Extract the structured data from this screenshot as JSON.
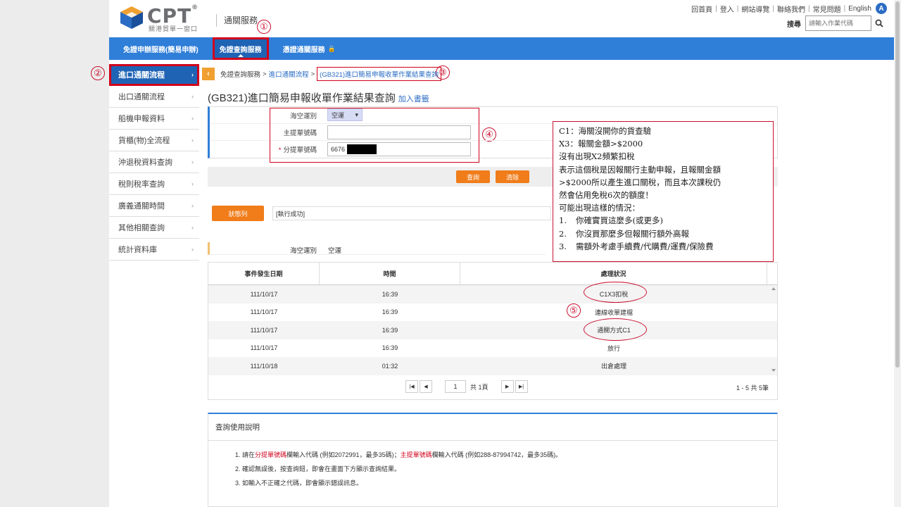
{
  "header": {
    "brand": "CPT",
    "reg": "®",
    "tagline": "關港貿單一窗口",
    "site_title": "通關服務",
    "top_links": [
      "回首頁",
      "登入",
      "網站導覽",
      "聯絡我們",
      "常見問題",
      "English"
    ],
    "globe_letter": "A",
    "search_label": "搜尋",
    "search_placeholder": "請輸入作業代碼"
  },
  "nav": {
    "items": [
      "免證申辦服務(簡易申辦)",
      "免證查詢服務",
      "憑證通關服務"
    ]
  },
  "annotations": {
    "a1": "①",
    "a2": "②",
    "a3": "③",
    "a4": "④",
    "a5": "⑤"
  },
  "sidebar": {
    "items": [
      "進口通關流程",
      "出口通關流程",
      "船機申報資料",
      "貨櫃(物)全流程",
      "沖退稅資料查詢",
      "稅則稅率查詢",
      "廣義通關時間",
      "其他相關查詢",
      "統計資料庫"
    ]
  },
  "breadcrumb": {
    "root": "免證查詢服務",
    "parent": "進口通關流程",
    "current": "(GB321)進口簡易申報收單作業結果查詢"
  },
  "page": {
    "title": "(GB321)進口簡易申報收單作業結果查詢",
    "bookmark": "加入書籤"
  },
  "form": {
    "transport_label": "海空運別",
    "transport_value": "空運",
    "master_label": "主提單號碼",
    "master_value": "",
    "house_label": "分提單號碼",
    "house_value": "6676",
    "query_button": "查詢",
    "clear_button": "清除"
  },
  "status": {
    "badge": "狀態列",
    "message": "[執行成功]"
  },
  "result": {
    "transport_label": "海空運別",
    "transport_value": "空運"
  },
  "table": {
    "headers": [
      "事件發生日期",
      "時間",
      "處理狀況"
    ],
    "rows": [
      [
        "111/10/17",
        "16:39",
        "C1X3扣稅"
      ],
      [
        "111/10/17",
        "16:39",
        "連線收單建檔"
      ],
      [
        "111/10/17",
        "16:39",
        "通關方式C1"
      ],
      [
        "111/10/17",
        "16:39",
        "放行"
      ],
      [
        "111/10/18",
        "01:32",
        "出倉處理"
      ]
    ]
  },
  "pager": {
    "page": "1",
    "total_pages": "共 1頁",
    "count": "1 - 5 共 5筆"
  },
  "help": {
    "title": "查詢使用說明",
    "line1_a": "1. 請在",
    "line1_b": "分提單號碼",
    "line1_c": "欄輸入代碼 (例如2072991，最多35碼)；",
    "line1_d": "主提單號碼",
    "line1_e": "欄輸入代碼 (例如288-87994742，最多35碼)。",
    "line2": "2. 確認無誤後，按查詢鈕，即會在畫面下方顯示查詢結果。",
    "line3": "3. 如輸入不正確之代碼，即會顯示錯誤訊息。"
  },
  "note": {
    "l1": "C1：海關沒開你的貨查驗",
    "l2": "X3：報關金額>$2000",
    "l3": "沒有出現X2頻繁扣稅",
    "l4": "表示這個稅是因報關行主動申報，且報關金額",
    "l5": ">$2000所以產生進口關稅，而且本次課稅仍",
    "l6": "然會佔用免稅6次的額度！",
    "l7": "可能出現這樣的情況：",
    "i1n": "1.",
    "i1": "你確實買這麼多(或更多)",
    "i2n": "2.",
    "i2": "你沒買那麼多但報關行額外高報",
    "i3n": "3.",
    "i3": "需額外考慮手續費/代購費/運費/保險費"
  }
}
